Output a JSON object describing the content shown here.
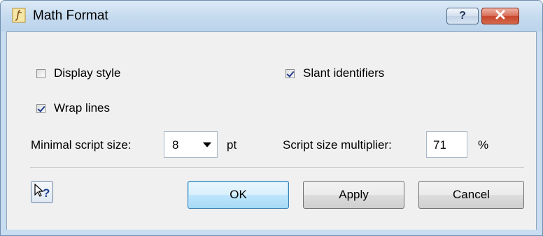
{
  "window": {
    "title": "Math Format",
    "app_icon": "math-format-icon",
    "help_icon": "?",
    "close_icon": "close-icon"
  },
  "options": {
    "display_style": {
      "label": "Display style",
      "checked": false
    },
    "slant_identifiers": {
      "label": "Slant identifiers",
      "checked": true
    },
    "wrap_lines": {
      "label": "Wrap lines",
      "checked": true
    }
  },
  "script_size": {
    "label": "Minimal script size:",
    "value": "8",
    "unit": "pt"
  },
  "multiplier": {
    "label": "Script size multiplier:",
    "value": "71",
    "unit": "%"
  },
  "buttons": {
    "ok": "OK",
    "apply": "Apply",
    "cancel": "Cancel"
  },
  "colors": {
    "title_bar": "#c3d9ee",
    "dialog_bg": "#f0f0f0",
    "close_red": "#c7452b",
    "default_button": "#bee6fd"
  }
}
